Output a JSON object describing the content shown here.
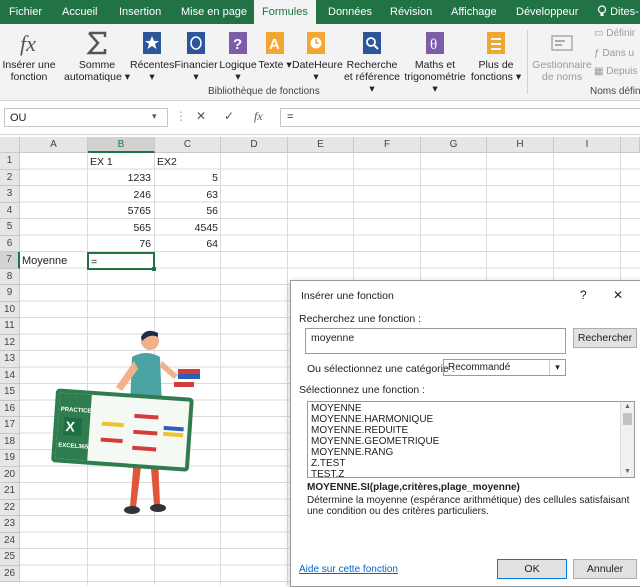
{
  "tabs": [
    "Fichier",
    "Accueil",
    "Insertion",
    "Mise en page",
    "Formules",
    "Données",
    "Révision",
    "Affichage",
    "Développeur",
    "Dites-"
  ],
  "active_tab": "Formules",
  "ribbon": {
    "insert_function": "Insérer une fonction",
    "autosum": "Somme automatique",
    "recent": "Récentes",
    "financial": "Financier",
    "logical": "Logique",
    "text": "Texte",
    "datetime": "DateHeure",
    "lookup": "Recherche et référence",
    "math": "Maths et trigonométrie",
    "more": "Plus de fonctions",
    "group_library": "Bibliothèque de fonctions",
    "name_manager": "Gestionnaire de noms",
    "define": "Définir",
    "use_in": "Dans u",
    "create_from": "Depuis",
    "group_names": "Noms défin"
  },
  "formula_bar": {
    "name_box": "OU",
    "cancel": "✕",
    "enter": "✓",
    "fx": "fx",
    "content": "="
  },
  "columns": [
    "A",
    "B",
    "C",
    "D",
    "E",
    "F",
    "G",
    "H",
    "I"
  ],
  "rows": [
    "1",
    "2",
    "3",
    "4",
    "5",
    "6",
    "7",
    "8",
    "9",
    "10",
    "11",
    "12",
    "13",
    "14",
    "15",
    "16",
    "17",
    "18",
    "19",
    "20",
    "21",
    "22",
    "23",
    "24",
    "25",
    "26"
  ],
  "cells": {
    "B1": "EX 1",
    "C1": "EX2",
    "B2": "1233",
    "C2": "5",
    "B3": "246",
    "C3": "63",
    "B4": "5765",
    "C4": "56",
    "B5": "565",
    "C5": "4545",
    "B6": "76",
    "C6": "64",
    "A7": "Moyenne",
    "B7": "="
  },
  "illustration": {
    "line1": "PRACTICE",
    "line2": "EXCEL365"
  },
  "dialog": {
    "title": "Insérer une fonction",
    "help_icon": "?",
    "close_icon": "✕",
    "search_label": "Recherchez une fonction :",
    "search_value": "moyenne",
    "search_button": "Rechercher",
    "category_label": "Ou sélectionnez une catégorie :",
    "category_value": "Recommandé",
    "select_label": "Sélectionnez une fonction :",
    "functions": [
      "MOYENNE",
      "MOYENNE.HARMONIQUE",
      "MOYENNE.REDUITE",
      "MOYENNE.GEOMETRIQUE",
      "MOYENNE.RANG",
      "Z.TEST",
      "TEST.Z"
    ],
    "signature": "MOYENNE.SI(plage,critères,plage_moyenne)",
    "description": "Détermine la moyenne (espérance arithmétique) des cellules satisfaisant une condition ou des critères particuliers.",
    "help_link": "Aide sur cette fonction",
    "ok": "OK",
    "cancel": "Annuler"
  },
  "colors": {
    "excel_green": "#217346",
    "accent_blue": "#0078d7"
  }
}
